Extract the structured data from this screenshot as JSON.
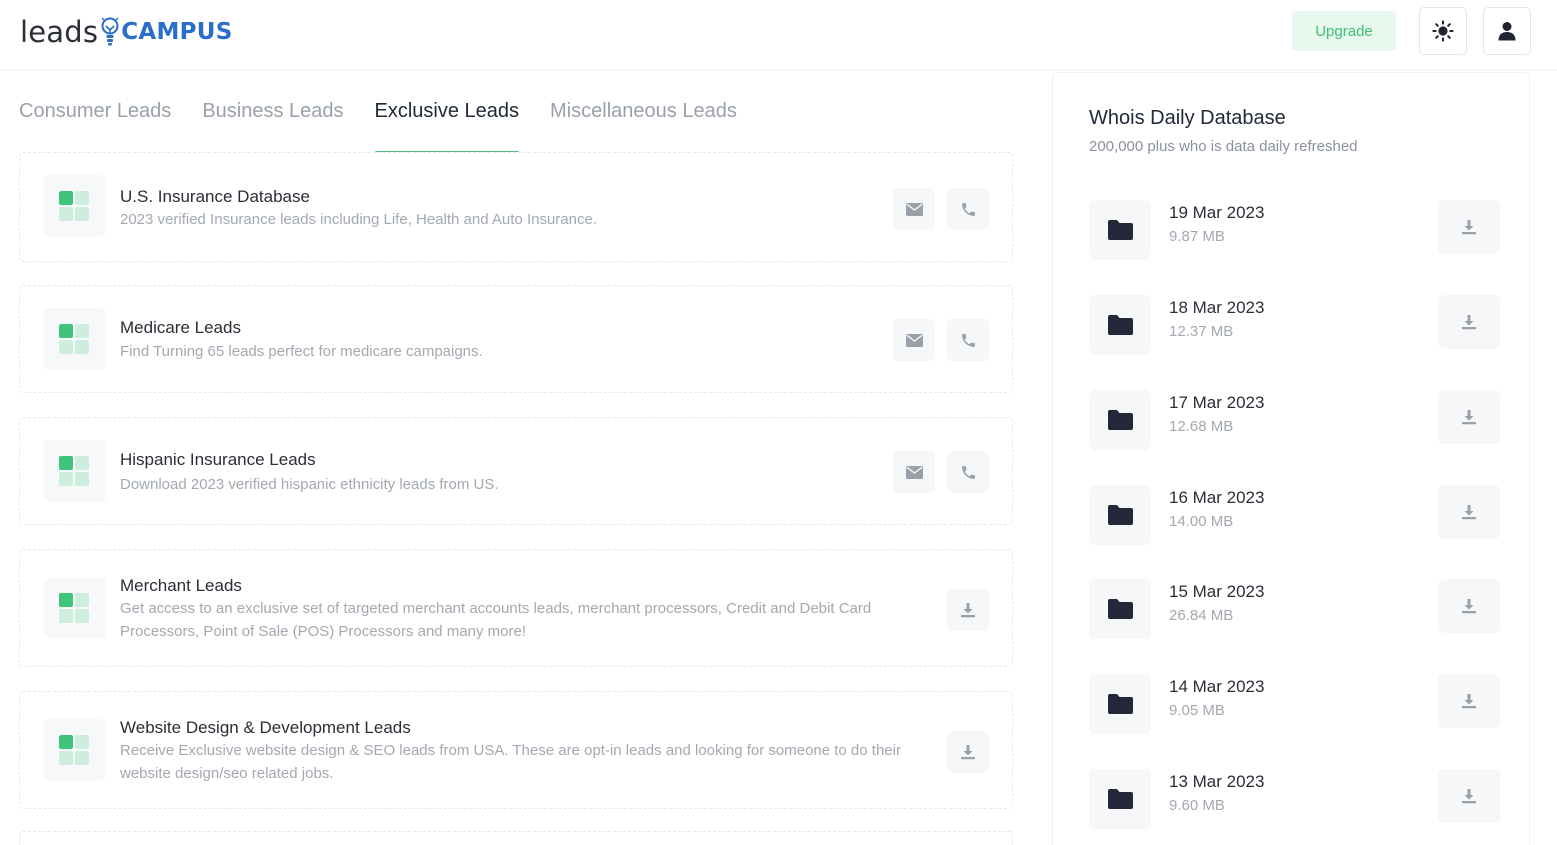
{
  "header": {
    "logo_text_1": "leads",
    "logo_text_2": "CAMPUS",
    "upgrade_label": "Upgrade"
  },
  "colors": {
    "accent_green": "#4cc384",
    "logo_blue": "#2a6ecb",
    "upgrade_bg": "#e9f8ef"
  },
  "tabs": [
    {
      "label": "Consumer Leads",
      "active": false
    },
    {
      "label": "Business Leads",
      "active": false
    },
    {
      "label": "Exclusive Leads",
      "active": true
    },
    {
      "label": "Miscellaneous Leads",
      "active": false
    }
  ],
  "leads": [
    {
      "title": "U.S. Insurance Database",
      "description": "2023 verified Insurance leads including Life, Health and Auto Insurance.",
      "actions": [
        "envelope-icon",
        "phone-icon"
      ]
    },
    {
      "title": "Medicare Leads",
      "description": "Find Turning 65 leads perfect for medicare campaigns.",
      "actions": [
        "envelope-icon",
        "phone-icon"
      ]
    },
    {
      "title": "Hispanic Insurance Leads",
      "description": "Download 2023 verified hispanic ethnicity leads from US.",
      "actions": [
        "envelope-icon",
        "phone-icon"
      ]
    },
    {
      "title": "Merchant Leads",
      "description": "Get access to an exclusive set of targeted merchant accounts leads, merchant processors, Credit and Debit Card Processors, Point of Sale (POS) Processors and many more!",
      "actions": [
        "download-icon"
      ]
    },
    {
      "title": "Website Design & Development Leads",
      "description": "Receive Exclusive website design & SEO leads from USA. These are opt-in leads and looking for someone to do their website design/seo related jobs.",
      "actions": [
        "download-icon"
      ]
    }
  ],
  "whois": {
    "title": "Whois Daily Database",
    "subtitle": "200,000 plus who is data daily refreshed",
    "items": [
      {
        "date": "19 Mar 2023",
        "size": "9.87 MB"
      },
      {
        "date": "18 Mar 2023",
        "size": "12.37 MB"
      },
      {
        "date": "17 Mar 2023",
        "size": "12.68 MB"
      },
      {
        "date": "16 Mar 2023",
        "size": "14.00 MB"
      },
      {
        "date": "15 Mar 2023",
        "size": "26.84 MB"
      },
      {
        "date": "14 Mar 2023",
        "size": "9.05 MB"
      },
      {
        "date": "13 Mar 2023",
        "size": "9.60 MB"
      }
    ]
  }
}
